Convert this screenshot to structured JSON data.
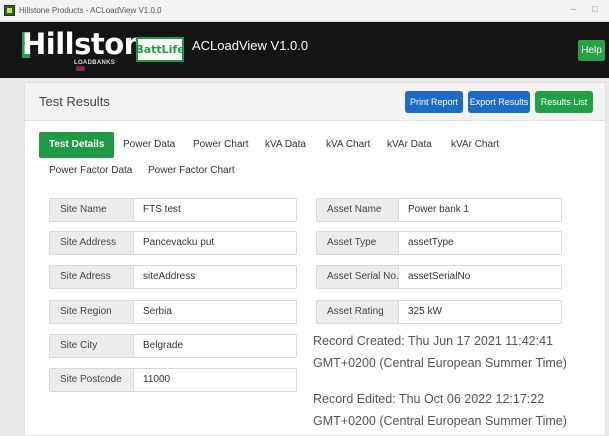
{
  "window": {
    "title": "Hillstone Products - ACLoadView V1.0.0",
    "minimize_glyph": "–",
    "maximize_glyph": "□"
  },
  "header": {
    "logo_text": "Hillstone",
    "logo_sub": "LOADBANKS",
    "badge": "BattLife",
    "title": "ACLoadView V1.0.0",
    "help_label": "Help"
  },
  "card": {
    "title": "Test Results",
    "print_label": "Print Report",
    "export_label": "Export Results",
    "results_list_label": "Results List"
  },
  "tabs": [
    "Test Details",
    "Power Data",
    "Power Chart",
    "kVA Data",
    "kVA Chart",
    "kVAr Data",
    "kVAr Chart",
    "Power Factor Data",
    "Power Factor Chart"
  ],
  "active_tab": "Test Details",
  "site_fields": [
    {
      "label": "Site Name",
      "value": "FTS test"
    },
    {
      "label": "Site Address",
      "value": "Pancevacku put"
    },
    {
      "label": "Site Adress",
      "value": "siteAddress"
    },
    {
      "label": "Site Region",
      "value": "Serbia"
    },
    {
      "label": "Site City",
      "value": "Belgrade"
    },
    {
      "label": "Site Postcode",
      "value": "11000"
    }
  ],
  "asset_fields": [
    {
      "label": "Asset Name",
      "value": "Power bank 1"
    },
    {
      "label": "Asset Type",
      "value": "assetType"
    },
    {
      "label": "Asset Serial No.",
      "value": "assetSerialNo"
    },
    {
      "label": "Asset Rating",
      "value": "325 kW"
    }
  ],
  "record_created": "Record Created: Thu Jun 17 2021 11:42:41 GMT+0200 (Central European Summer Time)",
  "record_edited": "Record Edited: Thu Oct 06 2022 12:17:22 GMT+0200 (Central European Summer Time)",
  "colors": {
    "brand_green": "#1f9a45",
    "primary_blue": "#1d6bc4",
    "header_black": "#141414"
  }
}
